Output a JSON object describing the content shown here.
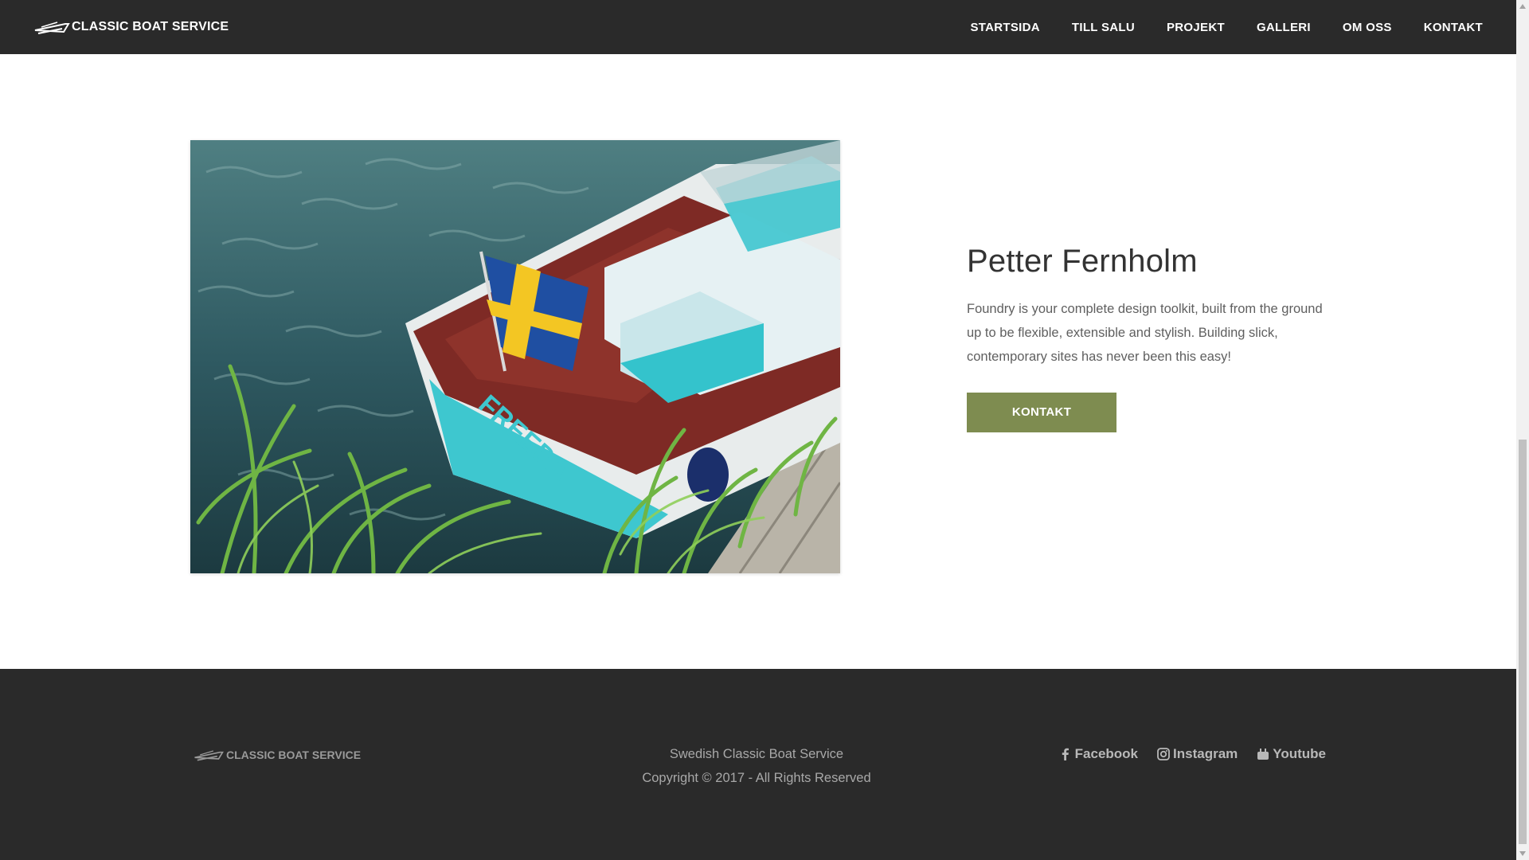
{
  "header": {
    "logo_text": "CLASSIC BOAT SERVICE",
    "nav": [
      {
        "label": "STARTSIDA"
      },
      {
        "label": "TILL SALU"
      },
      {
        "label": "PROJEKT"
      },
      {
        "label": "GALLERI"
      },
      {
        "label": "OM OSS"
      },
      {
        "label": "KONTAKT"
      }
    ]
  },
  "main": {
    "name": "Petter Fernholm",
    "description": "Foundry is your complete design toolkit, built from the ground up to be flexible, extensible and stylish. Building slick, contemporary sites has never been this easy!",
    "button_label": "KONTAKT",
    "photo_boat_name": "FREEDA"
  },
  "footer": {
    "logo_text": "CLASSIC BOAT SERVICE",
    "company": "Swedish Classic Boat Service",
    "copyright": "Copyright © 2017 - All Rights Reserved",
    "social": [
      {
        "label": "Facebook",
        "icon": "facebook-icon"
      },
      {
        "label": "Instagram",
        "icon": "instagram-icon"
      },
      {
        "label": "Youtube",
        "icon": "youtube-icon"
      }
    ]
  },
  "colors": {
    "nav_bg": "#2a2a2a",
    "button_bg": "#7e8c50",
    "footer_bg": "#2a2a2a"
  }
}
